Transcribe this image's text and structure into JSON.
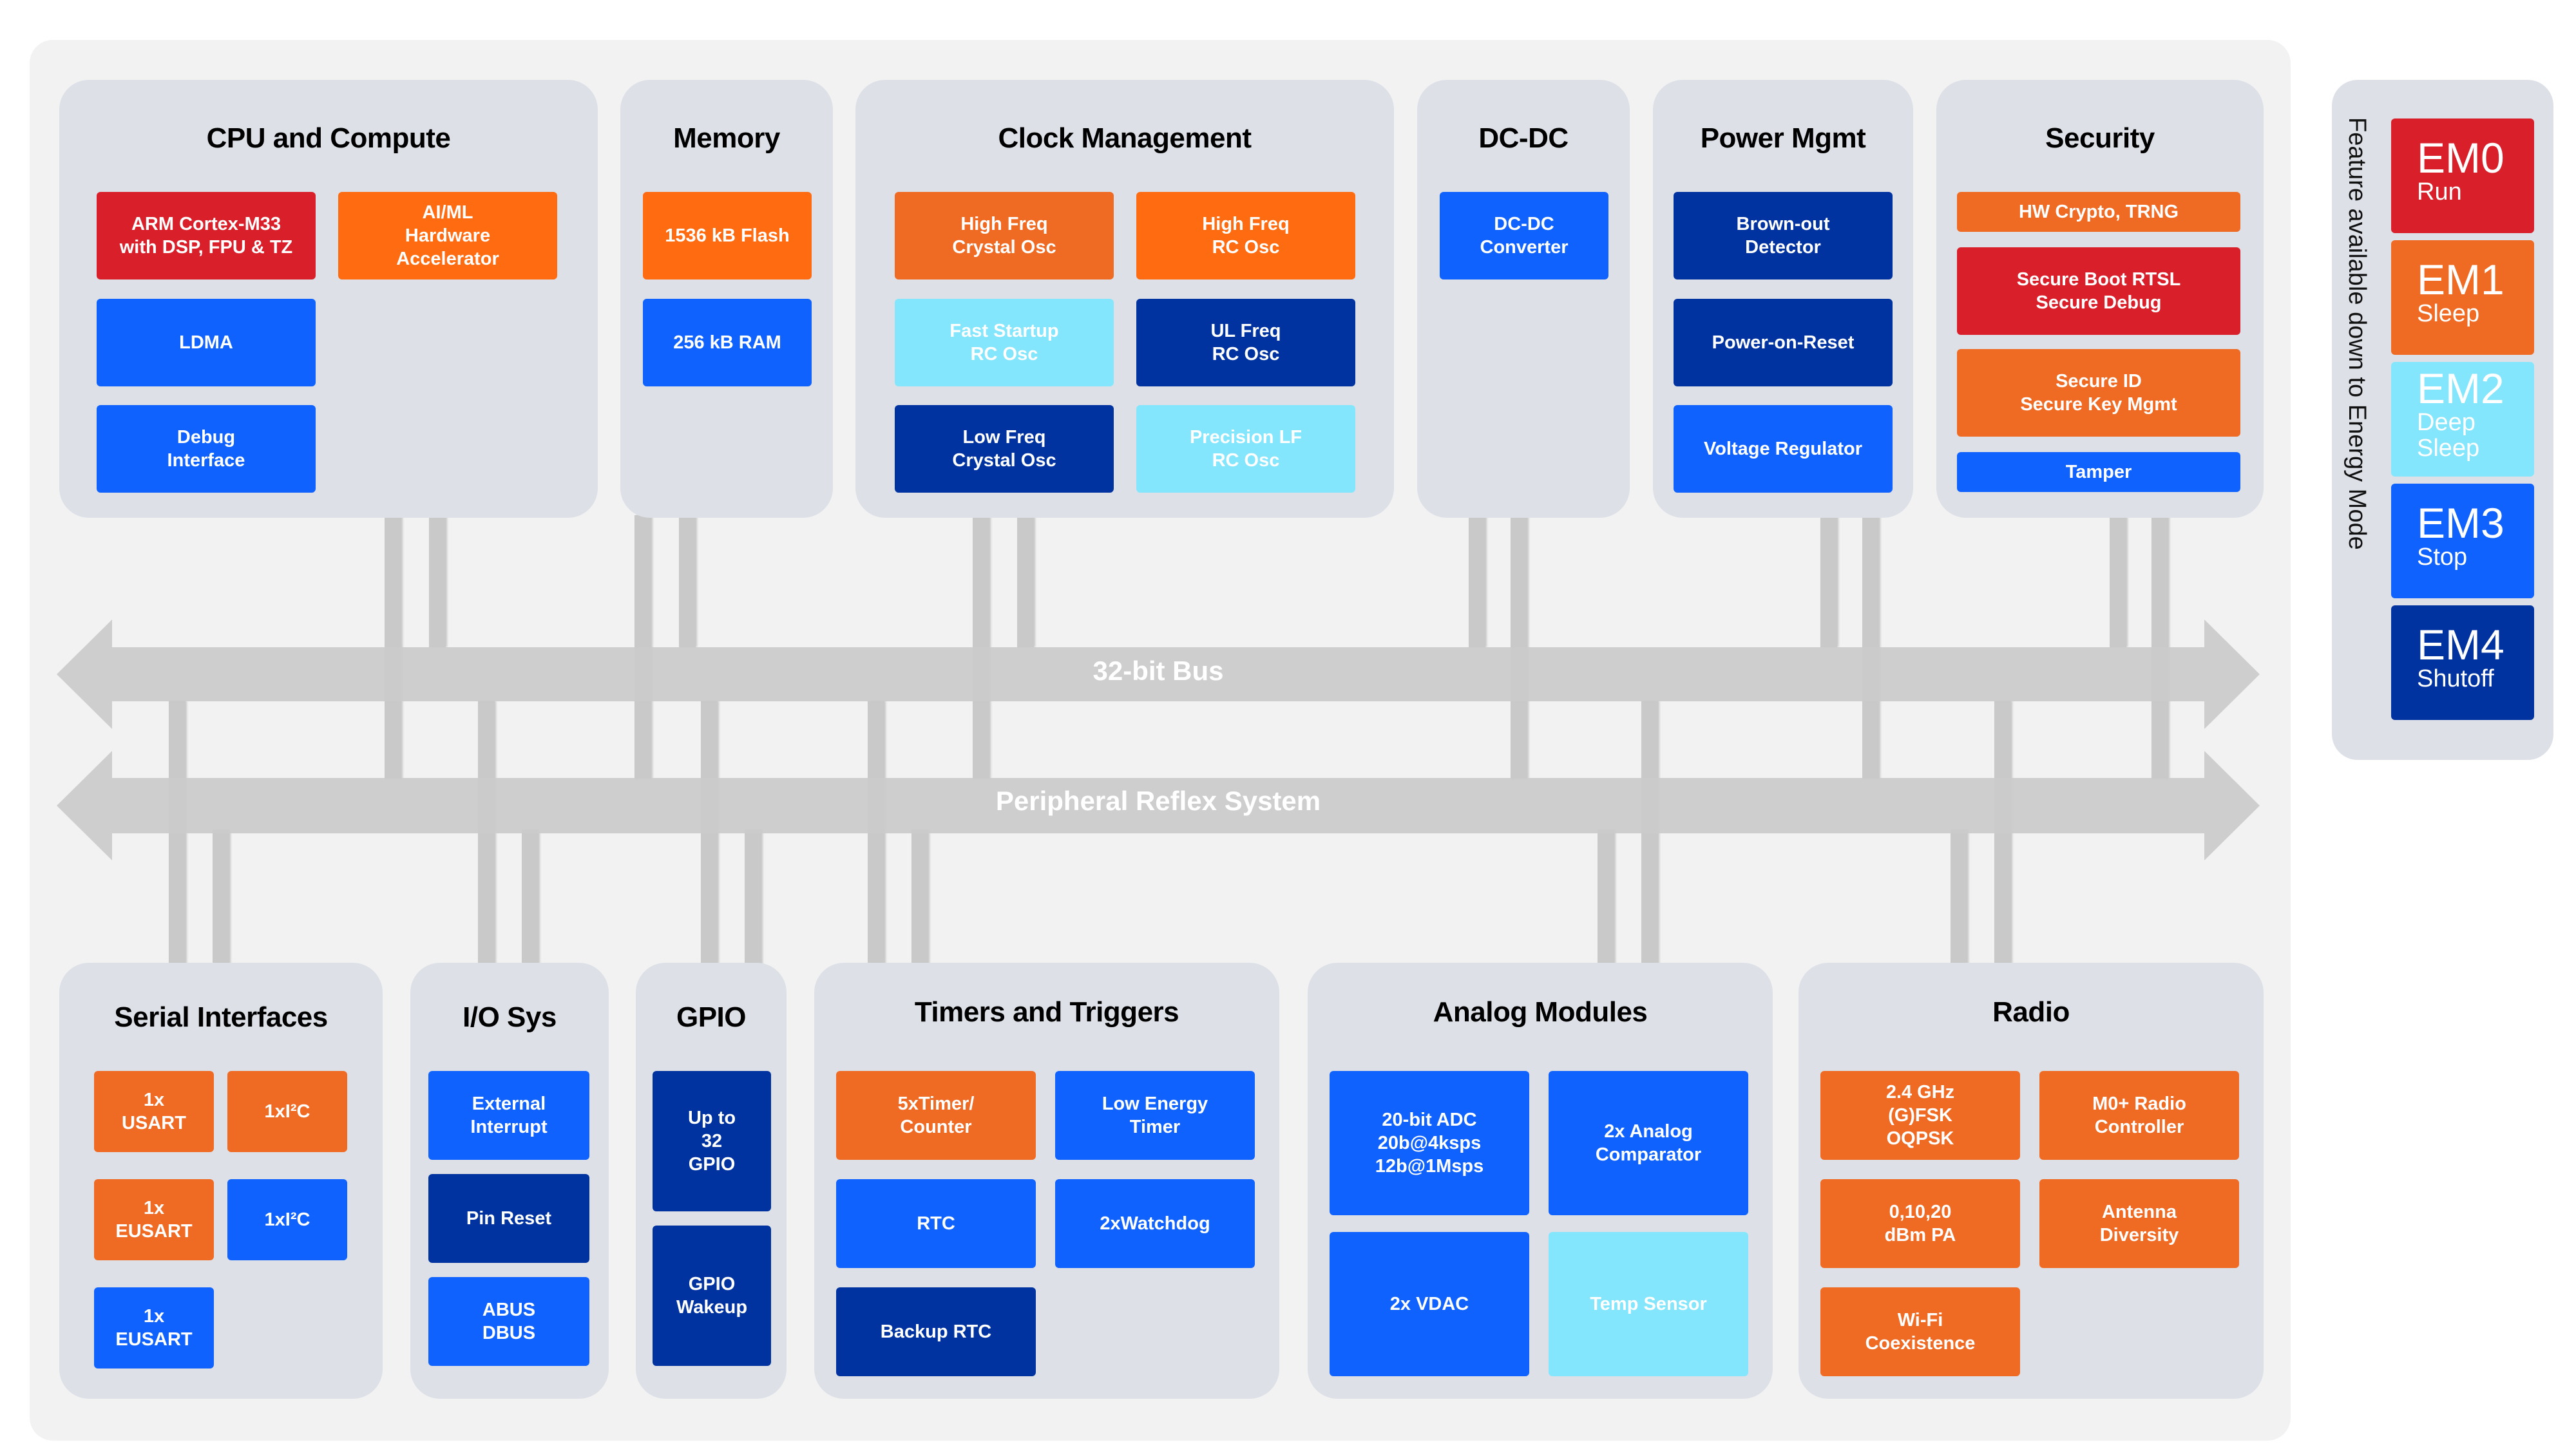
{
  "groups": {
    "cpu": {
      "title": "CPU and Compute",
      "blocks": [
        "ARM Cortex-M33\nwith DSP, FPU & TZ",
        "AI/ML\nHardware\nAccelerator",
        "LDMA",
        "Debug\nInterface"
      ]
    },
    "memory": {
      "title": "Memory",
      "blocks": [
        "1536 kB Flash",
        "256 kB RAM"
      ]
    },
    "clock": {
      "title": "Clock Management",
      "blocks": [
        "High Freq\nCrystal Osc",
        "High Freq\nRC Osc",
        "Fast Startup\nRC Osc",
        "UL Freq\nRC Osc",
        "Low Freq\nCrystal Osc",
        "Precision LF\nRC Osc"
      ]
    },
    "dcdc": {
      "title": "DC-DC",
      "blocks": [
        "DC-DC\nConverter"
      ]
    },
    "power": {
      "title": "Power Mgmt",
      "blocks": [
        "Brown-out\nDetector",
        "Power-on-Reset",
        "Voltage Regulator"
      ]
    },
    "security": {
      "title": "Security",
      "blocks": [
        "HW Crypto, TRNG",
        "Secure Boot RTSL\nSecure Debug",
        "Secure ID\nSecure Key Mgmt",
        "Tamper"
      ]
    },
    "serial": {
      "title": "Serial Interfaces",
      "blocks": [
        "1x\nUSART",
        "1xI²C",
        "1x\nEUSART",
        "1xI²C",
        "1x\nEUSART"
      ]
    },
    "io": {
      "title": "I/O Sys",
      "blocks": [
        "External\nInterrupt",
        "Pin Reset",
        "ABUS\nDBUS"
      ]
    },
    "gpio": {
      "title": "GPIO",
      "blocks": [
        "Up to\n32\nGPIO",
        "GPIO\nWakeup"
      ]
    },
    "timers": {
      "title": "Timers and Triggers",
      "blocks": [
        "5xTimer/\nCounter",
        "Low Energy\nTimer",
        "RTC",
        "2xWatchdog",
        "Backup RTC"
      ]
    },
    "analog": {
      "title": "Analog Modules",
      "blocks": [
        "20-bit ADC\n20b@4ksps\n12b@1Msps",
        "2x Analog\nComparator",
        "2x VDAC",
        "Temp Sensor"
      ]
    },
    "radio": {
      "title": "Radio",
      "blocks": [
        "2.4 GHz\n(G)FSK\nOQPSK",
        "M0+ Radio\nController",
        "0,10,20\ndBm PA",
        "Antenna\nDiversity",
        "Wi-Fi\nCoexistence"
      ]
    }
  },
  "buses": {
    "main": "32-bit Bus",
    "prs": "Peripheral Reflex System"
  },
  "legend": {
    "caption": "Feature available down to Energy Mode",
    "modes": [
      {
        "code": "EM0",
        "name": "Run",
        "color": "#d81f2a"
      },
      {
        "code": "EM1",
        "name": "Sleep",
        "color": "#ef6b24"
      },
      {
        "code": "EM2",
        "name": "Deep\nSleep",
        "color": "#84e6fd"
      },
      {
        "code": "EM3",
        "name": "Stop",
        "color": "#1062fe"
      },
      {
        "code": "EM4",
        "name": "Shutoff",
        "color": "#0033a0"
      }
    ]
  },
  "colors": {
    "em0_run": "#d81f2a",
    "em1_sleep": "#ef6b24",
    "em2_deep_sleep": "#84e6fd",
    "em3_stop": "#1062fe",
    "em4_shutoff": "#0033a0",
    "bus": "#cbcbcb",
    "group_bg": "#dde1e7"
  }
}
